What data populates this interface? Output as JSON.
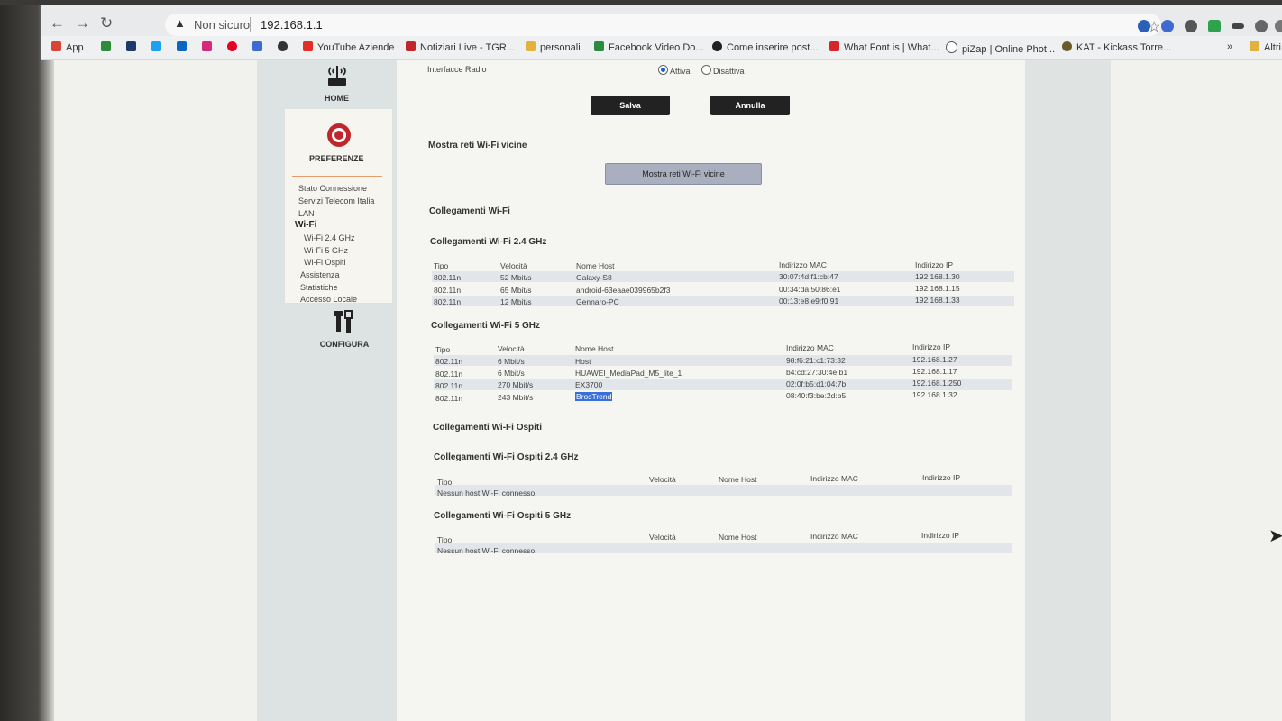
{
  "browser": {
    "security_label": "Non sicuro",
    "url": "192.168.1.1",
    "bookmarks": [
      "App",
      "YouTube Aziende",
      "Notiziari Live - TGR...",
      "personali",
      "Facebook Video Do...",
      "Come inserire post...",
      "What Font is | What...",
      "piZap | Online Phot...",
      "KAT - Kickass Torre...",
      "Altri"
    ],
    "more": "»"
  },
  "nav": {
    "home": "HOME",
    "preferenze": "PREFERENZE",
    "configura": "CONFIGURA",
    "submenu": [
      "Stato Connessione",
      "Servizi Telecom Italia",
      "LAN",
      "Wi-Fi",
      "Wi-Fi 2.4 GHz",
      "Wi-Fi 5 GHz",
      "Wi-Fi Ospiti",
      "Assistenza",
      "Statistiche",
      "Accesso Locale"
    ]
  },
  "radio": {
    "label": "Interfacce Radio",
    "on": "Attiva",
    "off": "Disattiva",
    "selected": "Attiva"
  },
  "buttons": {
    "save": "Salva",
    "cancel": "Annulla",
    "scan": "Mostra reti Wi-Fi vicine"
  },
  "sections": {
    "scan_title": "Mostra reti Wi-Fi vicine",
    "wifi": "Collegamenti Wi-Fi",
    "wifi24": "Collegamenti Wi-Fi 2.4 GHz",
    "wifi5": "Collegamenti Wi-Fi 5 GHz",
    "guest": "Collegamenti Wi-Fi Ospiti",
    "guest24": "Collegamenti Wi-Fi Ospiti 2.4 GHz",
    "guest5": "Collegamenti Wi-Fi Ospiti 5 GHz"
  },
  "headers": [
    "Tipo",
    "Velocità",
    "Nome Host",
    "Indirizzo MAC",
    "Indirizzo IP"
  ],
  "wifi24_rows": [
    [
      "802.11n",
      "52 Mbit/s",
      "Galaxy-S8",
      "30:07:4d:f1:cb:47",
      "192.168.1.30"
    ],
    [
      "802.11n",
      "65 Mbit/s",
      "android-63eaae039965b2f3",
      "00:34:da:50:86:e1",
      "192.168.1.15"
    ],
    [
      "802.11n",
      "12 Mbit/s",
      "Gennaro-PC",
      "00:13:e8:e9:f0:91",
      "192.168.1.33"
    ]
  ],
  "wifi5_rows": [
    [
      "802.11n",
      "6 Mbit/s",
      "Host",
      "98:f6:21:c1:73:32",
      "192.168.1.27"
    ],
    [
      "802.11n",
      "6 Mbit/s",
      "HUAWEI_MediaPad_M5_lite_1",
      "b4:cd:27:30:4e:b1",
      "192.168.1.17"
    ],
    [
      "802.11n",
      "270 Mbit/s",
      "EX3700",
      "02:0f:b5:d1:04:7b",
      "192.168.1.250"
    ],
    [
      "802.11n",
      "243 Mbit/s",
      "BrosTrend",
      "08:40:f3:be:2d:b5",
      "192.168.1.32"
    ]
  ],
  "no_host": "Nessun host Wi-Fi connesso."
}
